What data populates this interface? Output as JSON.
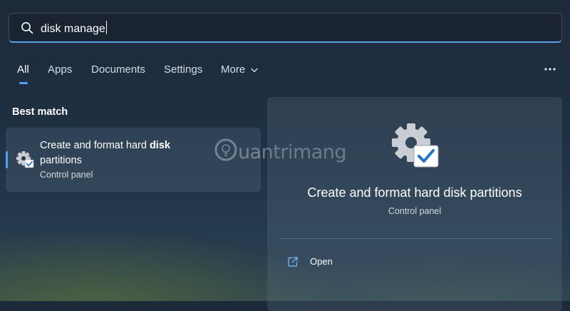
{
  "search": {
    "value": "disk manage"
  },
  "tabs": [
    {
      "label": "All",
      "active": true
    },
    {
      "label": "Apps"
    },
    {
      "label": "Documents"
    },
    {
      "label": "Settings"
    },
    {
      "label": "More"
    }
  ],
  "best_match": {
    "heading": "Best match",
    "result": {
      "title_prefix": "Create and format hard ",
      "title_bold": "disk",
      "title_suffix": " partitions",
      "subtitle": "Control panel"
    }
  },
  "detail": {
    "title": "Create and format hard disk partitions",
    "subtitle": "Control panel",
    "actions": [
      {
        "label": "Open",
        "icon": "open-external-icon"
      }
    ]
  },
  "watermark": {
    "text": "uantrimang"
  },
  "colors": {
    "accent": "#4ea1f3",
    "search_bg": "#1a2330",
    "panel_bg": "rgba(110,130,150,0.22)"
  },
  "icons": {
    "search": "search-icon",
    "result": "control-panel-gear-check-icon",
    "more": "chevron-down-icon",
    "overflow": "more-dots-icon"
  }
}
